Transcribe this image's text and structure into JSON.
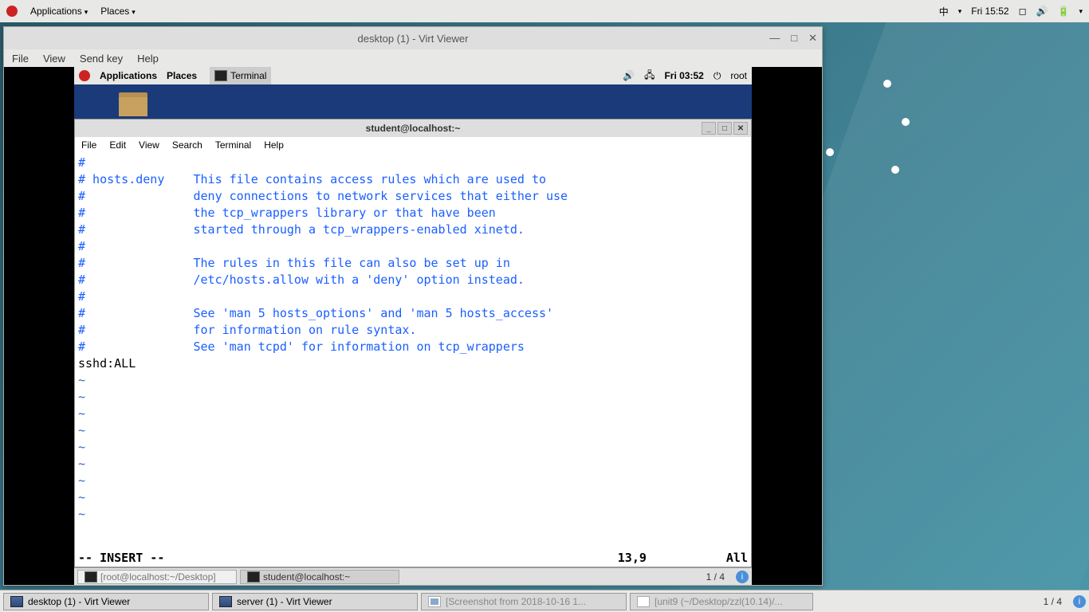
{
  "outer_top": {
    "applications": "Applications",
    "places": "Places",
    "ime": "中",
    "clock": "Fri 15:52"
  },
  "virt": {
    "title": "desktop (1) - Virt Viewer",
    "menu": [
      "File",
      "View",
      "Send key",
      "Help"
    ]
  },
  "inner_top": {
    "applications": "Applications",
    "places": "Places",
    "terminal_tab": "Terminal",
    "clock": "Fri 03:52",
    "user": "root"
  },
  "term": {
    "title": "student@localhost:~",
    "menu": [
      "File",
      "Edit",
      "View",
      "Search",
      "Terminal",
      "Help"
    ],
    "lines": [
      "#",
      "# hosts.deny    This file contains access rules which are used to",
      "#               deny connections to network services that either use",
      "#               the tcp_wrappers library or that have been",
      "#               started through a tcp_wrappers-enabled xinetd.",
      "#",
      "#               The rules in this file can also be set up in",
      "#               /etc/hosts.allow with a 'deny' option instead.",
      "#",
      "#               See 'man 5 hosts_options' and 'man 5 hosts_access'",
      "#               for information on rule syntax.",
      "#               See 'man tcpd' for information on tcp_wrappers"
    ],
    "plain_line": "sshd:ALL",
    "mode": "-- INSERT --",
    "pos": "13,9",
    "scroll": "All"
  },
  "inner_tasks": {
    "t1": "[root@localhost:~/Desktop]",
    "t2": "student@localhost:~",
    "ws": "1 / 4"
  },
  "outer_tasks": {
    "t1": "desktop (1) - Virt Viewer",
    "t2": "server (1) - Virt Viewer",
    "t3": "[Screenshot from 2018-10-16 1...",
    "t4": "[unit9 (~/Desktop/zzl(10.14)/...",
    "ws": "1 / 4"
  }
}
